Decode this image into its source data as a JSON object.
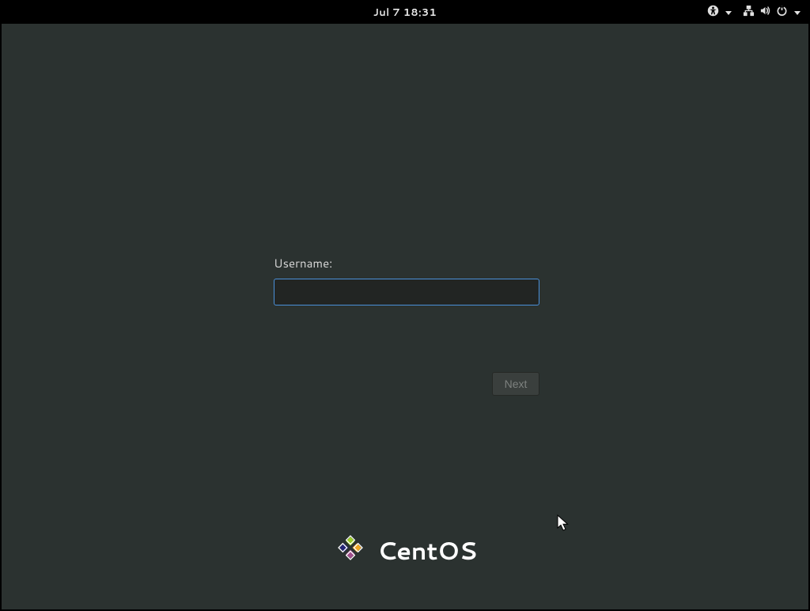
{
  "topbar": {
    "datetime": "Jul 7  18:31"
  },
  "login": {
    "label": "Username:",
    "value": "",
    "placeholder": "",
    "next_label": "Next"
  },
  "branding": {
    "name": "CentOS"
  },
  "icons": {
    "accessibility": "accessibility-icon",
    "network": "network-wired-icon",
    "volume": "volume-icon",
    "power": "power-icon"
  }
}
